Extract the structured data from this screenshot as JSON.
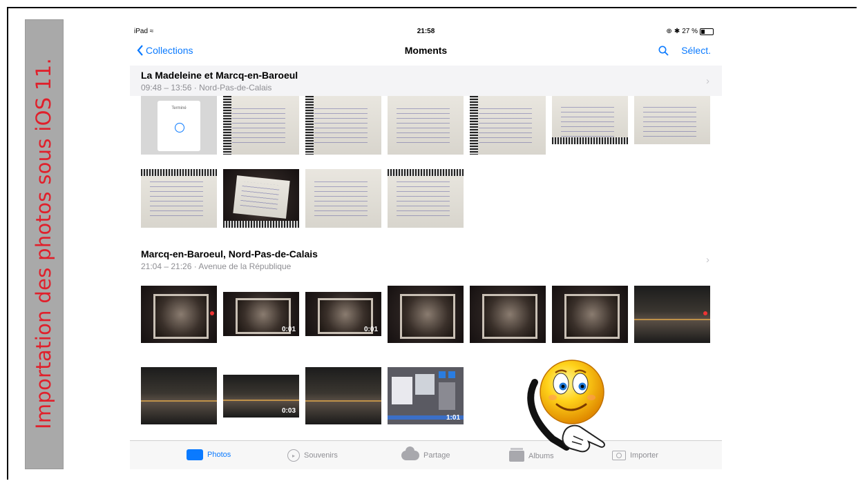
{
  "slide": {
    "sidebar_title": "Importation des photos sous iOS 11.",
    "accent_color": "#e0202b",
    "sidebar_bg": "#a9a9a9"
  },
  "statusbar": {
    "device": "iPad",
    "time": "21:58",
    "battery": "27 %"
  },
  "navbar": {
    "back_label": "Collections",
    "title": "Moments",
    "select_label": "Sélect."
  },
  "sections": [
    {
      "title": "La Madeleine et Marcq-en-Baroeul",
      "subtitle": "09:48 – 13:56 · Nord-Pas-de-Calais",
      "phone_screen_text": "Terminé"
    },
    {
      "title": "Marcq-en-Baroeul, Nord-Pas-de-Calais",
      "subtitle": "21:04 – 21:26 · Avenue de la République",
      "durations": [
        "0:01",
        "0:01",
        "0:03",
        "1:01"
      ]
    }
  ],
  "tabbar": {
    "tabs": [
      {
        "label": "Photos",
        "icon": "photos-icon",
        "active": true
      },
      {
        "label": "Souvenirs",
        "icon": "memories-icon",
        "active": false
      },
      {
        "label": "Partage",
        "icon": "cloud-icon",
        "active": false
      },
      {
        "label": "Albums",
        "icon": "albums-icon",
        "active": false
      },
      {
        "label": "Importer",
        "icon": "camera-icon",
        "active": false
      }
    ],
    "active_color": "#0a7aff"
  }
}
